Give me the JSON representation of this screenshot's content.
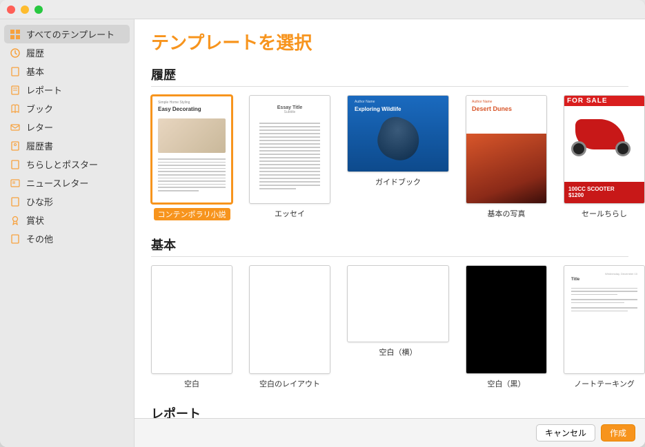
{
  "header": {
    "title": "テンプレートを選択"
  },
  "sidebar": {
    "items": [
      {
        "label": "すべてのテンプレート",
        "icon": "grid"
      },
      {
        "label": "履歴",
        "icon": "clock"
      },
      {
        "label": "基本",
        "icon": "doc"
      },
      {
        "label": "レポート",
        "icon": "doc"
      },
      {
        "label": "ブック",
        "icon": "book"
      },
      {
        "label": "レター",
        "icon": "envelope"
      },
      {
        "label": "履歴書",
        "icon": "doc"
      },
      {
        "label": "ちらしとポスター",
        "icon": "doc"
      },
      {
        "label": "ニュースレター",
        "icon": "news"
      },
      {
        "label": "ひな形",
        "icon": "doc"
      },
      {
        "label": "賞状",
        "icon": "award"
      },
      {
        "label": "その他",
        "icon": "doc"
      }
    ]
  },
  "sections": {
    "recent": {
      "title": "履歴",
      "items": [
        {
          "label": "コンテンポラリ小説",
          "art_title": "Easy Decorating",
          "art_pre": "Simple Home Styling"
        },
        {
          "label": "エッセイ",
          "art_title": "Essay Title",
          "art_sub": "Subtitle"
        },
        {
          "label": "ガイドブック",
          "art_title": "Exploring Wildlife",
          "art_author": "Author Name"
        },
        {
          "label": "基本の写真",
          "art_title": "Desert Dunes",
          "art_author": "Author Name"
        },
        {
          "label": "セールちらし",
          "art_head": "FOR SALE",
          "art_tag1": "100CC SCOOTER",
          "art_tag2": "$1200"
        }
      ]
    },
    "basic": {
      "title": "基本",
      "items": [
        {
          "label": "空白"
        },
        {
          "label": "空白のレイアウト"
        },
        {
          "label": "空白（横）"
        },
        {
          "label": "空白（黒）"
        },
        {
          "label": "ノートテーキング",
          "art_t": "Title"
        }
      ]
    },
    "report": {
      "title": "レポート"
    }
  },
  "footer": {
    "cancel": "キャンセル",
    "create": "作成"
  }
}
